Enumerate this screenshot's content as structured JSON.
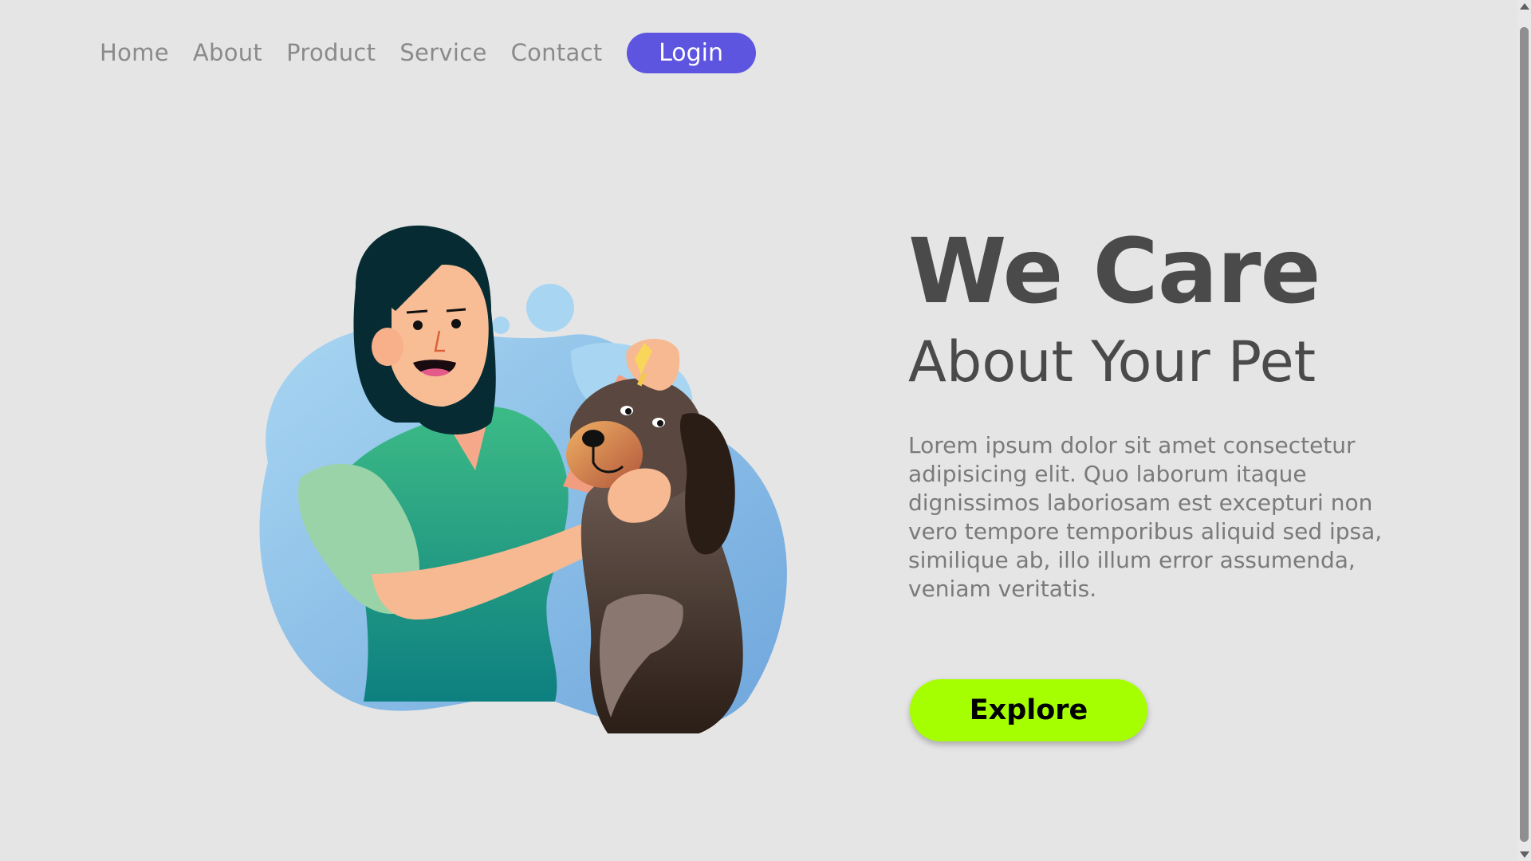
{
  "nav": {
    "items": [
      {
        "label": "Home"
      },
      {
        "label": "About"
      },
      {
        "label": "Product"
      },
      {
        "label": "Service"
      },
      {
        "label": "Contact"
      }
    ],
    "login_label": "Login"
  },
  "hero": {
    "title": "We Care",
    "subtitle": "About Your Pet",
    "body": "Lorem ipsum dolor sit amet consectetur adipisicing elit. Quo laborum itaque dignissimos laboriosam est excepturi non vero tempore temporibus aliquid sed ipsa, similique ab, illo illum error assumenda, veniam veritatis.",
    "explore_label": "Explore"
  },
  "colors": {
    "background": "#e5e5e5",
    "login_button": "#5d55e0",
    "explore_button": "#a6ff00",
    "heading": "#4a4a4a",
    "nav_text": "#8a8a8a",
    "body_text": "#7a7a7a"
  },
  "illustration": {
    "subject": "woman-giving-ear-drops-to-dog"
  }
}
